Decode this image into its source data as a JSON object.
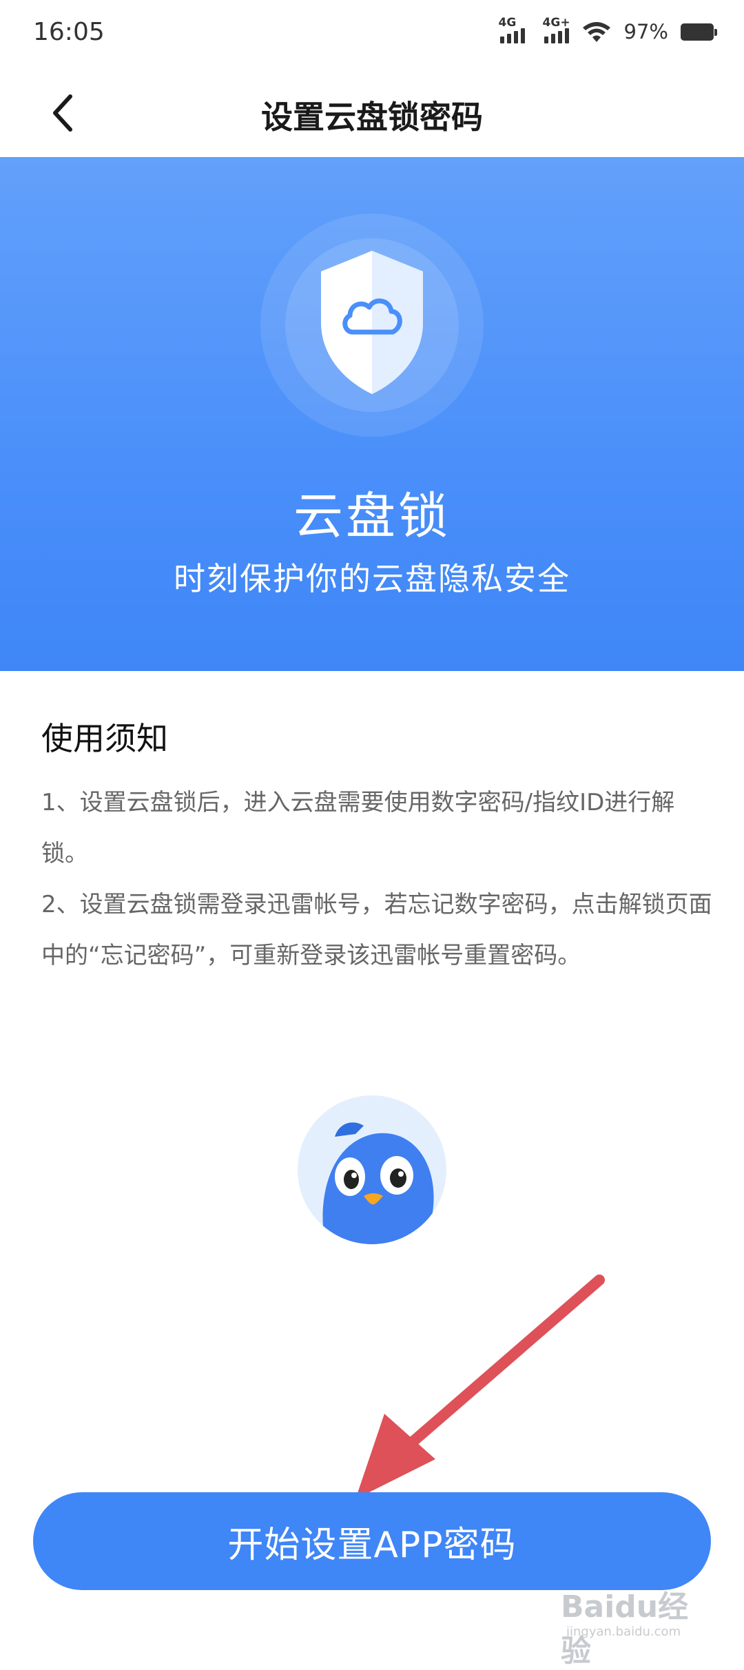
{
  "status_bar": {
    "time": "16:05",
    "network_1": "4G",
    "network_2": "4G+",
    "battery": "97%"
  },
  "header": {
    "title": "设置云盘锁密码",
    "back_icon": "chevron-left-icon"
  },
  "hero": {
    "icon": "shield-cloud-icon",
    "title": "云盘锁",
    "subtitle": "时刻保护你的云盘隐私安全"
  },
  "notice": {
    "heading": "使用须知",
    "items": [
      "1、设置云盘锁后，进入云盘需要使用数字密码/指纹ID进行解锁。",
      "2、设置云盘锁需登录迅雷帐号，若忘记数字密码，点击解锁页面中的“忘记密码”，可重新登录该迅雷帐号重置密码。"
    ]
  },
  "mascot": {
    "icon": "bird-mascot-icon"
  },
  "cta": {
    "label": "开始设置APP密码"
  },
  "watermark": {
    "text": "Baidu经验",
    "sub": "jingyan.baidu.com"
  },
  "colors": {
    "primary": "#3f86f7",
    "hero_top": "#62a0fa",
    "annotation_arrow": "#de5158"
  }
}
